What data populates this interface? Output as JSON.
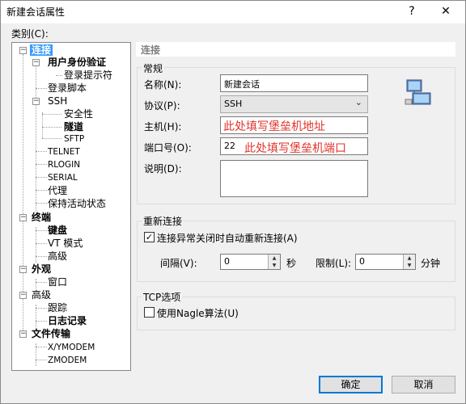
{
  "window": {
    "title": "新建会话属性",
    "help": "?",
    "close": "✕"
  },
  "category_label": "类别(C):",
  "tree": {
    "conn": "连接",
    "auth": "用户身份验证",
    "login_prompt": "登录提示符",
    "login_script": "登录脚本",
    "ssh": "SSH",
    "security": "安全性",
    "tunnel": "隧道",
    "sftp": "SFTP",
    "telnet": "TELNET",
    "rlogin": "RLOGIN",
    "serial": "SERIAL",
    "proxy": "代理",
    "keepalive": "保持活动状态",
    "terminal": "终端",
    "keyboard": "键盘",
    "vt_mode": "VT 模式",
    "term_adv": "高级",
    "appearance": "外观",
    "window": "窗口",
    "advanced": "高级",
    "trace": "跟踪",
    "log": "日志记录",
    "file_transfer": "文件传输",
    "xymodem": "X/YMODEM",
    "zmodem": "ZMODEM"
  },
  "panel_title": "连接",
  "general": {
    "title": "常规",
    "name_label": "名称(N):",
    "name_value": "新建会话",
    "protocol_label": "协议(P):",
    "protocol_value": "SSH",
    "host_label": "主机(H):",
    "host_note": "此处填写堡垒机地址",
    "port_label": "端口号(O):",
    "port_value": "22",
    "port_note": "此处填写堡垒机端口",
    "desc_label": "说明(D):",
    "desc_value": ""
  },
  "reconnect": {
    "title": "重新连接",
    "auto_label": "连接异常关闭时自动重新连接(A)",
    "auto_checked": true,
    "interval_label": "间隔(V):",
    "interval_value": "0",
    "interval_unit": "秒",
    "limit_label": "限制(L):",
    "limit_value": "0",
    "limit_unit": "分钟"
  },
  "tcp": {
    "title": "TCP选项",
    "nagle_label": "使用Nagle算法(U)",
    "nagle_checked": false
  },
  "buttons": {
    "ok": "确定",
    "cancel": "取消"
  },
  "icons": {
    "network": "network-computer-icon",
    "checkmark": "✓",
    "spin_up": "▲",
    "spin_down": "▼",
    "dropdown": "⌄"
  }
}
